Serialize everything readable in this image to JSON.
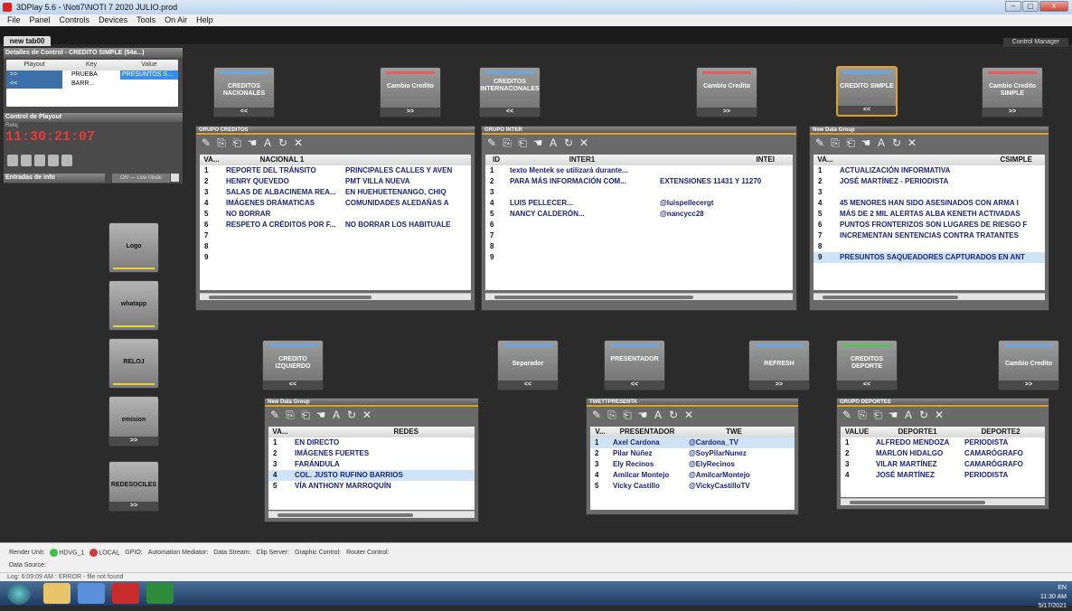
{
  "window": {
    "title": "3DPlay 5.6 - \\Noti7\\NOTI 7 2020 JULIO.prod",
    "min": "–",
    "max": "▢",
    "close": "x"
  },
  "menu": [
    "File",
    "Panel",
    "Controls",
    "Devices",
    "Tools",
    "On Air",
    "Help"
  ],
  "tab": {
    "label": "new tab00",
    "control_manager": "Control Manager"
  },
  "left_panel": {
    "title": "Detalles de Control - CREDITO SIMPLE (54a...)",
    "headers": [
      "Playout",
      "Key",
      "Value"
    ],
    "rows": [
      {
        "playout": ">>",
        "key": "PRUEBA BARR...",
        "value": "PRESUNTOS S..."
      },
      {
        "playout": "<<",
        "key": "",
        "value": ""
      }
    ],
    "playout_section": "Control de Playout",
    "reloj_label": "Reloj",
    "clock": "11:30:21:07",
    "entradas": "Entradas de info",
    "live_mode": "ON — Live Mode"
  },
  "side_buttons": [
    {
      "label": "Logo",
      "btm": ""
    },
    {
      "label": "whatapp",
      "btm": ""
    },
    {
      "label": "RELOJ",
      "btm": ""
    },
    {
      "label": "emision",
      "btm": ">>"
    },
    {
      "label": "REDESOCILES",
      "btm": ">>"
    }
  ],
  "top_buttons": [
    {
      "label": "CREDITOS NACIONALES",
      "btm": "<<",
      "bar": "blue"
    },
    {
      "label": "Cambio Credito",
      "btm": ">>",
      "bar": "red"
    },
    {
      "label": "CREDITOS INTERNACONALES",
      "btm": "<<",
      "bar": "blue"
    },
    {
      "label": "Cambio Credito",
      "btm": ">>",
      "bar": "red"
    },
    {
      "label": "CREDITO SIMPLE",
      "btm": "<<",
      "bar": "blue"
    },
    {
      "label": "Cambio Credito SIMPLE",
      "btm": ">>",
      "bar": "red"
    }
  ],
  "mid_buttons": [
    {
      "label": "CREDITO IZQUIERDO",
      "btm": "<<",
      "bar": "blue"
    },
    {
      "label": "Separador",
      "btm": "<<",
      "bar": "blue"
    },
    {
      "label": "PRESENTADOR",
      "btm": "<<",
      "bar": "blue"
    },
    {
      "label": "REFRESH",
      "btm": ">>",
      "bar": "blue"
    },
    {
      "label": "CREDITOS DEPORTE",
      "btm": "<<",
      "bar": "green"
    },
    {
      "label": "Cambio Credito",
      "btm": ">>",
      "bar": "blue"
    }
  ],
  "groups": {
    "creditos": {
      "title": "GRUPO CREDITOS",
      "headers": [
        "VA...",
        "NACIONAL 1",
        ""
      ],
      "rows": [
        [
          "1",
          "REPORTE DEL TRÁNSITO",
          "PRINCIPALES CALLES Y AVEN"
        ],
        [
          "2",
          "HENRY QUEVEDO",
          "PMT VILLA NUEVA"
        ],
        [
          "3",
          "SALAS DE ALBACINEMA REA...",
          "EN HUEHUETENANGO, CHIQ"
        ],
        [
          "4",
          "IMÁGENES DRÁMATICAS",
          "COMUNIDADES ALEDAÑAS A"
        ],
        [
          "5",
          "NO BORRAR",
          ""
        ],
        [
          "6",
          "RESPETO A CRÉDITOS POR F...",
          "NO BORRAR LOS HABITUALE"
        ],
        [
          "7",
          "",
          ""
        ],
        [
          "8",
          "",
          ""
        ],
        [
          "9",
          "",
          ""
        ]
      ]
    },
    "inter": {
      "title": "GRUPO INTER",
      "headers": [
        "ID",
        "INTER1",
        "INTEI"
      ],
      "rows": [
        [
          "1",
          "texto Mentek se utilizará durante...",
          ""
        ],
        [
          "2",
          "PARA MÁS INFORMACIÓN COM...",
          "EXTENSIONES 11431 Y 11270"
        ],
        [
          "3",
          "",
          ""
        ],
        [
          "4",
          "LUIS PELLECER...",
          "@luispellecergt"
        ],
        [
          "5",
          "NANCY CALDERÓN...",
          "@nancycc28"
        ],
        [
          "6",
          "",
          ""
        ],
        [
          "7",
          "",
          ""
        ],
        [
          "8",
          "",
          ""
        ],
        [
          "9",
          "",
          ""
        ]
      ]
    },
    "csimple": {
      "title": "New Data Group",
      "headers": [
        "VA...",
        "CSIMPLE"
      ],
      "rows": [
        [
          "1",
          "ACTUALIZACIÓN INFORMATIVA"
        ],
        [
          "2",
          "JOSÉ MARTÍNEZ - PERIODISTA"
        ],
        [
          "3",
          ""
        ],
        [
          "4",
          "45 MENORES HAN SIDO ASESINADOS CON ARMA I"
        ],
        [
          "5",
          "MÁS DE 2 MIL ALERTAS ALBA KENETH ACTIVADAS"
        ],
        [
          "6",
          "PUNTOS FRONTERIZOS SON LUGARES DE RIESGO F"
        ],
        [
          "7",
          "INCREMENTAN SENTENCIAS CONTRA TRATANTES"
        ],
        [
          "8",
          ""
        ],
        [
          "9",
          "PRESUNTOS SAQUEADORES CAPTURADOS EN ANT"
        ]
      ]
    },
    "redes": {
      "title": "New Data Group",
      "headers": [
        "VA...",
        "REDES"
      ],
      "rows": [
        [
          "1",
          "EN DIRECTO"
        ],
        [
          "2",
          "IMÁGENES FUERTES"
        ],
        [
          "3",
          "FARÁNDULA"
        ],
        [
          "4",
          "COL. JUSTO RUFINO BARRIOS"
        ],
        [
          "5",
          "VÍA ANTHONY MARROQUÍN"
        ]
      ]
    },
    "tweet": {
      "title": "TWETTPRESENTA",
      "headers": [
        "V...",
        "PRESENTADOR",
        "TWE"
      ],
      "rows": [
        [
          "1",
          "Axel Cardona",
          "@Cardona_TV"
        ],
        [
          "2",
          "Pilar Núñez",
          "@SoyPilarNunez"
        ],
        [
          "3",
          "Ely Recinos",
          "@ElyRecinos"
        ],
        [
          "4",
          "Amilcar Montejo",
          "@AmilcarMontejo"
        ],
        [
          "5",
          "Vicky Castillo",
          "@VickyCastilloTV"
        ]
      ]
    },
    "deportes": {
      "title": "GRUPO DEPORTES",
      "headers": [
        "VALUE",
        "DEPORTE1",
        "DEPORTE2"
      ],
      "rows": [
        [
          "1",
          "ALFREDO MENDOZA",
          "PERIODISTA"
        ],
        [
          "2",
          "MARLON HIDALGO",
          "CAMARÓGRAFO"
        ],
        [
          "3",
          "VILAR MARTÍNEZ",
          "CAMARÓGRAFO"
        ],
        [
          "4",
          "JOSÉ MARTÍNEZ",
          "PERIODISTA"
        ]
      ]
    }
  },
  "status": {
    "render_unit": "Render Unit:",
    "hdvg": "HDVG_1",
    "local": "LOCAL",
    "gpio": "GPIO:",
    "automation": "Automation Mediator:",
    "datastream": "Data Stream:",
    "clip": "Clip Server:",
    "graphic": "Graphic Control:",
    "router": "Router Control:",
    "datasource": "Data Source:",
    "log": "Log: 6:09:09 AM : ERROR - file not found"
  },
  "tray": {
    "lang": "EN",
    "time": "11:30 AM",
    "date": "5/17/2021"
  }
}
